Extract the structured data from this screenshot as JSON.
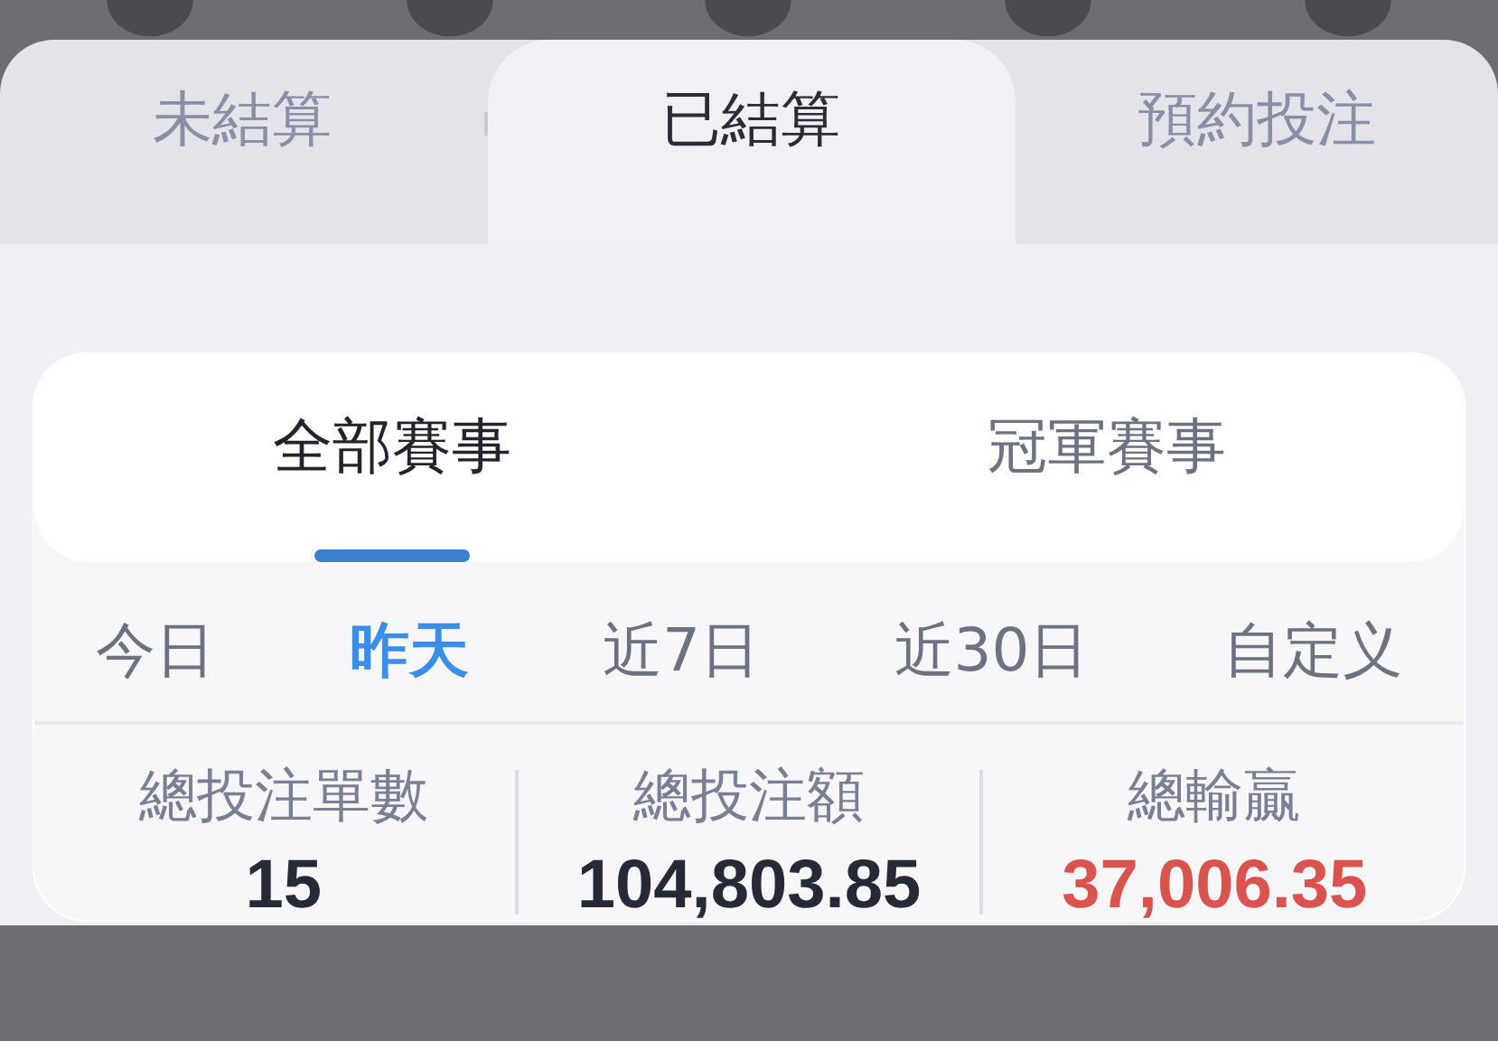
{
  "tabs": [
    {
      "label": "未結算",
      "selected": false
    },
    {
      "label": "已結算",
      "selected": true
    },
    {
      "label": "預約投注",
      "selected": false
    }
  ],
  "event_tabs": [
    {
      "label": "全部賽事",
      "selected": true
    },
    {
      "label": "冠軍賽事",
      "selected": false
    }
  ],
  "date_filters": [
    {
      "label": "今日",
      "selected": false
    },
    {
      "label": "昨天",
      "selected": true
    },
    {
      "label": "近7日",
      "selected": false
    },
    {
      "label": "近30日",
      "selected": false
    },
    {
      "label": "自定义",
      "selected": false
    }
  ],
  "stats": [
    {
      "label": "總投注單數",
      "value": "15",
      "color": "#262a36"
    },
    {
      "label": "總投注額",
      "value": "104,803.85",
      "color": "#262a36"
    },
    {
      "label": "總輸贏",
      "value": "37,006.35",
      "color": "#d9534f"
    }
  ]
}
